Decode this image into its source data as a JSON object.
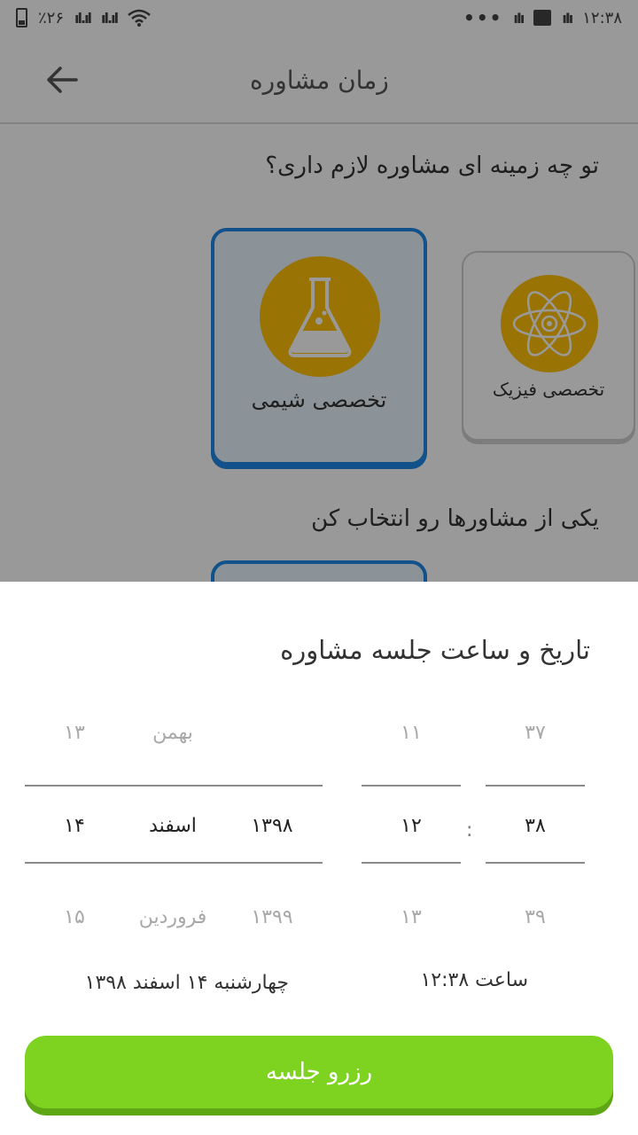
{
  "status_bar": {
    "battery_percent": "٪۲۶",
    "time": "۱۲:۳۸",
    "more_dots": "•••"
  },
  "header": {
    "title": "زمان مشاوره"
  },
  "content": {
    "question_field": "تو چه زمینه ای مشاوره لازم داری؟",
    "cards": [
      {
        "label": "تخصصی شیمی",
        "icon": "flask-icon",
        "selected": true
      },
      {
        "label": "تخصصی فیزیک",
        "icon": "atom-icon",
        "selected": false
      }
    ],
    "question_advisor": "یکی از مشاورها رو انتخاب کن"
  },
  "sheet": {
    "title": "تاریخ و ساعت جلسه مشاوره",
    "picker": {
      "date": {
        "day": {
          "prev": "۱۳",
          "selected": "۱۴",
          "next": "۱۵"
        },
        "month": {
          "prev": "بهمن",
          "selected": "اسفند",
          "next": "فروردین"
        },
        "year": {
          "prev": "",
          "selected": "۱۳۹۸",
          "next": "۱۳۹۹"
        }
      },
      "time": {
        "hour": {
          "prev": "۱۱",
          "selected": "۱۲",
          "next": "۱۳"
        },
        "separator": ":",
        "minute": {
          "prev": "۳۷",
          "selected": "۳۸",
          "next": "۳۹"
        }
      }
    },
    "date_summary": "چهارشنبه  ۱۴  اسفند  ۱۳۹۸",
    "time_summary": "ساعت ۱۲:۳۸",
    "reserve_button": "رزرو جلسه"
  },
  "colors": {
    "accent_green": "#7ed321",
    "selection_blue": "#1e88e5",
    "icon_yellow": "#ffc107"
  }
}
